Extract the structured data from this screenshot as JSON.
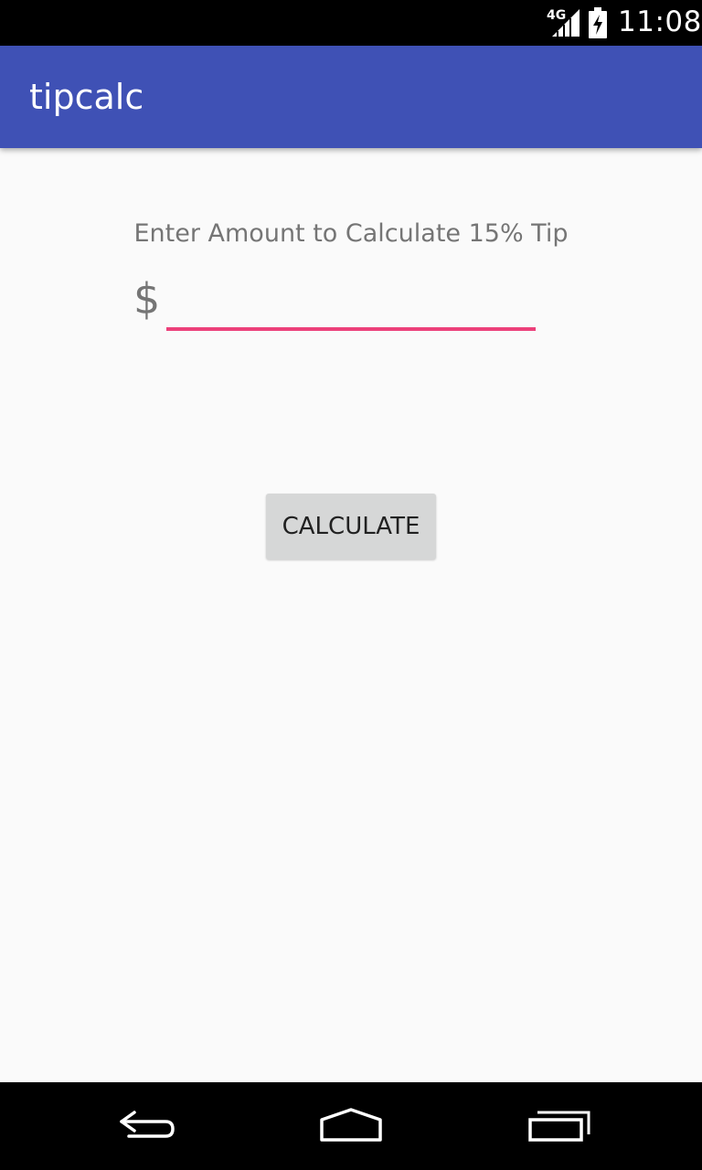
{
  "status_bar": {
    "network": "4G",
    "time": "11:08",
    "icons": [
      "signal-icon",
      "battery-charging-icon"
    ]
  },
  "app_bar": {
    "title": "tipcalc",
    "color": "#3f51b5"
  },
  "form": {
    "prompt": "Enter Amount to Calculate 15% Tip",
    "currency_symbol": "$",
    "amount_value": "",
    "amount_placeholder": "",
    "accent_color": "#ec407a"
  },
  "actions": {
    "calculate_label": "CALCULATE"
  },
  "nav_bar": {
    "icons": [
      "back-icon",
      "home-icon",
      "recents-icon"
    ]
  }
}
